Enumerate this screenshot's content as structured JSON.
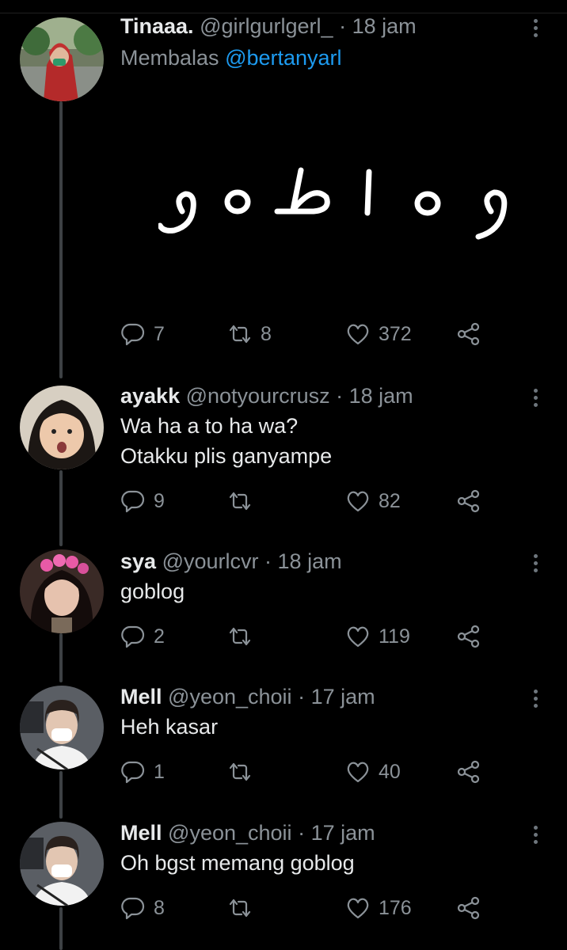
{
  "tweets": [
    {
      "name": "Tinaaa.",
      "handle": "@girlgurlgerl_",
      "time": "18 jam",
      "reply_prefix": "Membalas",
      "reply_to": "@bertanyarl",
      "image_alt": "goblog",
      "lines": [],
      "replies": "7",
      "retweets": "8",
      "likes": "372"
    },
    {
      "name": "ayakk",
      "handle": "@notyourcrusz",
      "time": "18 jam",
      "lines": [
        "Wa ha a to ha wa?",
        "Otakku plis ganyampe"
      ],
      "replies": "9",
      "retweets": "",
      "likes": "82"
    },
    {
      "name": "sya",
      "handle": "@yourlcvr",
      "time": "18 jam",
      "lines": [
        "goblog"
      ],
      "replies": "2",
      "retweets": "",
      "likes": "119"
    },
    {
      "name": "Mell",
      "handle": "@yeon_choii",
      "time": "17 jam",
      "lines": [
        "Heh kasar"
      ],
      "replies": "1",
      "retweets": "",
      "likes": "40"
    },
    {
      "name": "Mell",
      "handle": "@yeon_choii",
      "time": "17 jam",
      "lines": [
        "Oh bgst memang goblog"
      ],
      "replies": "8",
      "retweets": "",
      "likes": "176"
    }
  ],
  "separator": "·",
  "icons": [
    "reply-icon",
    "retweet-icon",
    "like-icon",
    "share-icon",
    "more-icon"
  ],
  "colors": {
    "background": "#000000",
    "text": "#e7e9ea",
    "muted": "#8b9298",
    "link": "#1d9bf0",
    "thread": "#3d4144"
  }
}
